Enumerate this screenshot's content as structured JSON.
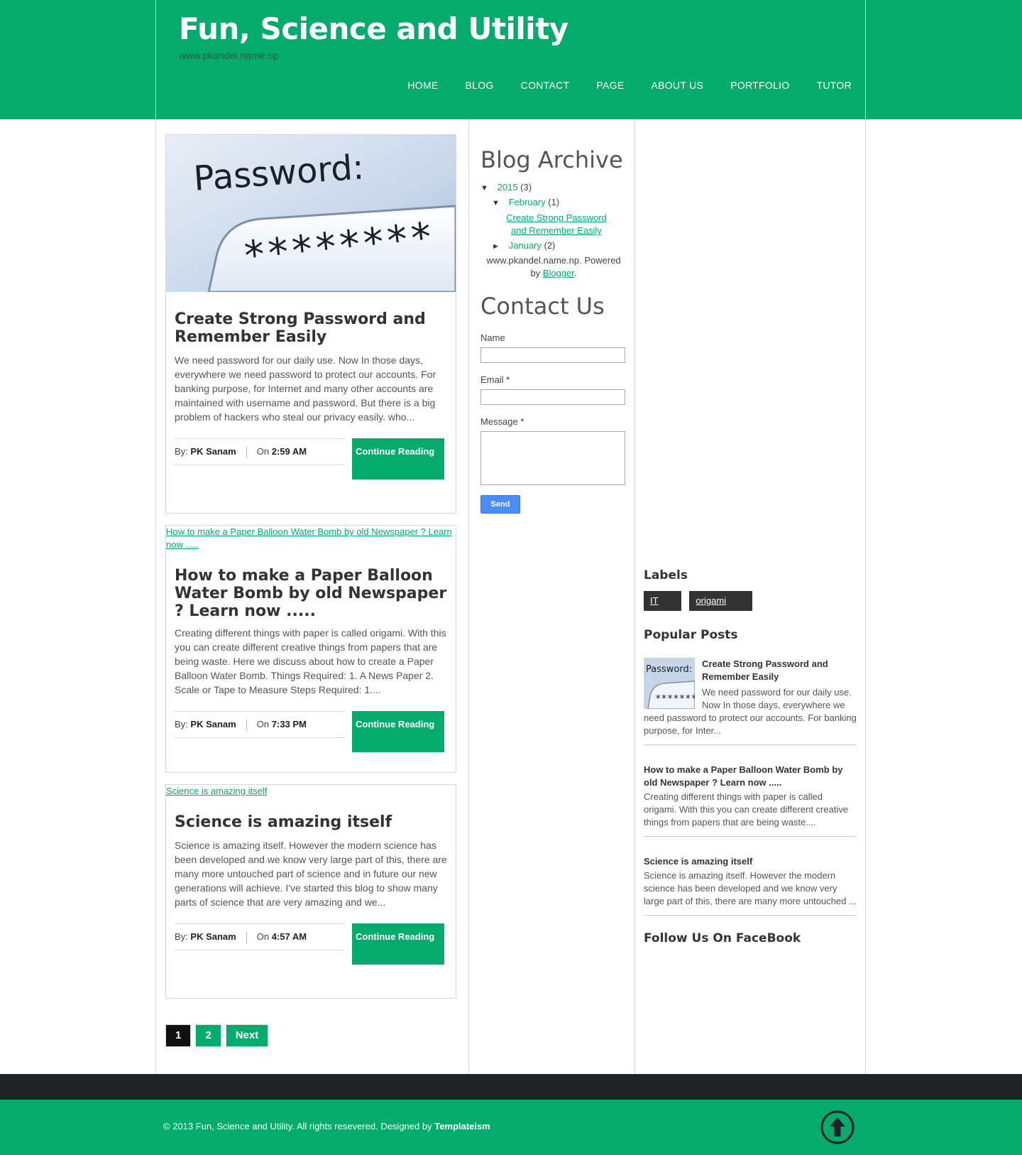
{
  "header": {
    "title": "Fun, Science and Utility",
    "description": "www.pkandel.name.np",
    "nav": [
      "HOME",
      "BLOG",
      "CONTACT",
      "PAGE",
      "ABOUT US",
      "PORTFOLIO",
      "TUTOR"
    ]
  },
  "posts": [
    {
      "title": "Create Strong Password and Remember Easily",
      "excerpt": "We need password for our daily use. Now In those days, everywhere we need password to protect our accounts. For banking purpose, for Internet and many other accounts are maintained with username and password.  But there is a big problem of hackers who steal our privacy easily. who...",
      "by_label": "By:",
      "author": "PK Sanam",
      "on_label": "On",
      "time": "2:59 AM",
      "continue": "Continue Reading",
      "image_text": "Password:"
    },
    {
      "title": "How to make a Paper Balloon Water Bomb by old Newspaper ? Learn now .....",
      "image_alt": "How to make a Paper Balloon Water Bomb by old Newspaper ? Learn now .....",
      "excerpt": "Creating different things with paper is called origami. With this you can create different creative things from papers that are being waste. Here we discuss about how to create a Paper Balloon  Water Bomb.  Things Required: 1. A News Paper 2. Scale or Tape to Measure Steps Required: 1....",
      "by_label": "By:",
      "author": "PK Sanam",
      "on_label": "On",
      "time": "7:33 PM",
      "continue": "Continue Reading"
    },
    {
      "title": "Science is amazing itself",
      "image_alt": "Science is amazing itself",
      "excerpt": "Science is amazing itself. However the modern science has been developed and we know very large part of this, there are many more untouched part of science and in future our new generations will achieve. I've started this blog to show many parts of science that are very amazing and we...",
      "by_label": "By:",
      "author": "PK Sanam",
      "on_label": "On",
      "time": "4:57 AM",
      "continue": "Continue Reading"
    }
  ],
  "pager": {
    "current": "1",
    "page2": "2",
    "next": "Next"
  },
  "archive": {
    "title": "Blog Archive",
    "year": "2015",
    "year_count": "(3)",
    "month1": "February",
    "month1_count": "(1)",
    "month1_post": "Create Strong Password and Remember Easily",
    "month2": "January",
    "month2_count": "(2)",
    "powered_text": "www.pkandel.name.np. Powered by",
    "powered_link": "Blogger",
    "powered_end": "."
  },
  "contact": {
    "title": "Contact Us",
    "name_label": "Name",
    "email_label": "Email",
    "message_label": "Message",
    "required": "*",
    "send": "Send"
  },
  "labels": {
    "title": "Labels",
    "items": [
      "IT",
      "origami"
    ]
  },
  "popular": {
    "title": "Popular Posts",
    "items": [
      {
        "title": "Create Strong Password and Remember Easily",
        "text": "We need password for our daily use. Now In those days, everywhere we need password to protect our accounts. For banking purpose, for Inter..."
      },
      {
        "title": "How to make a Paper Balloon Water Bomb by old Newspaper ? Learn now .....",
        "text": "Creating different things with paper is called origami. With this you can create different creative things from papers that are being waste...."
      },
      {
        "title": "Science is amazing itself",
        "text": "Science is amazing itself. However the modern science has been developed and we know very large part of this, there are many more untouched ..."
      }
    ]
  },
  "follow": {
    "title": "Follow Us On FaceBook"
  },
  "footer": {
    "copyright": "© 2013 Fun, Science and Utility. All rights resevered. Designed by",
    "designer": "Templateism"
  },
  "icons": {
    "back_to_top": "arrow-up-circle-icon",
    "expanded": "triangle-down-icon",
    "collapsed": "triangle-right-icon"
  },
  "colors": {
    "accent": "#05ab6c",
    "footer_dark": "#1f2326",
    "label_bg": "#333333",
    "send_button": "#4b8df8"
  }
}
